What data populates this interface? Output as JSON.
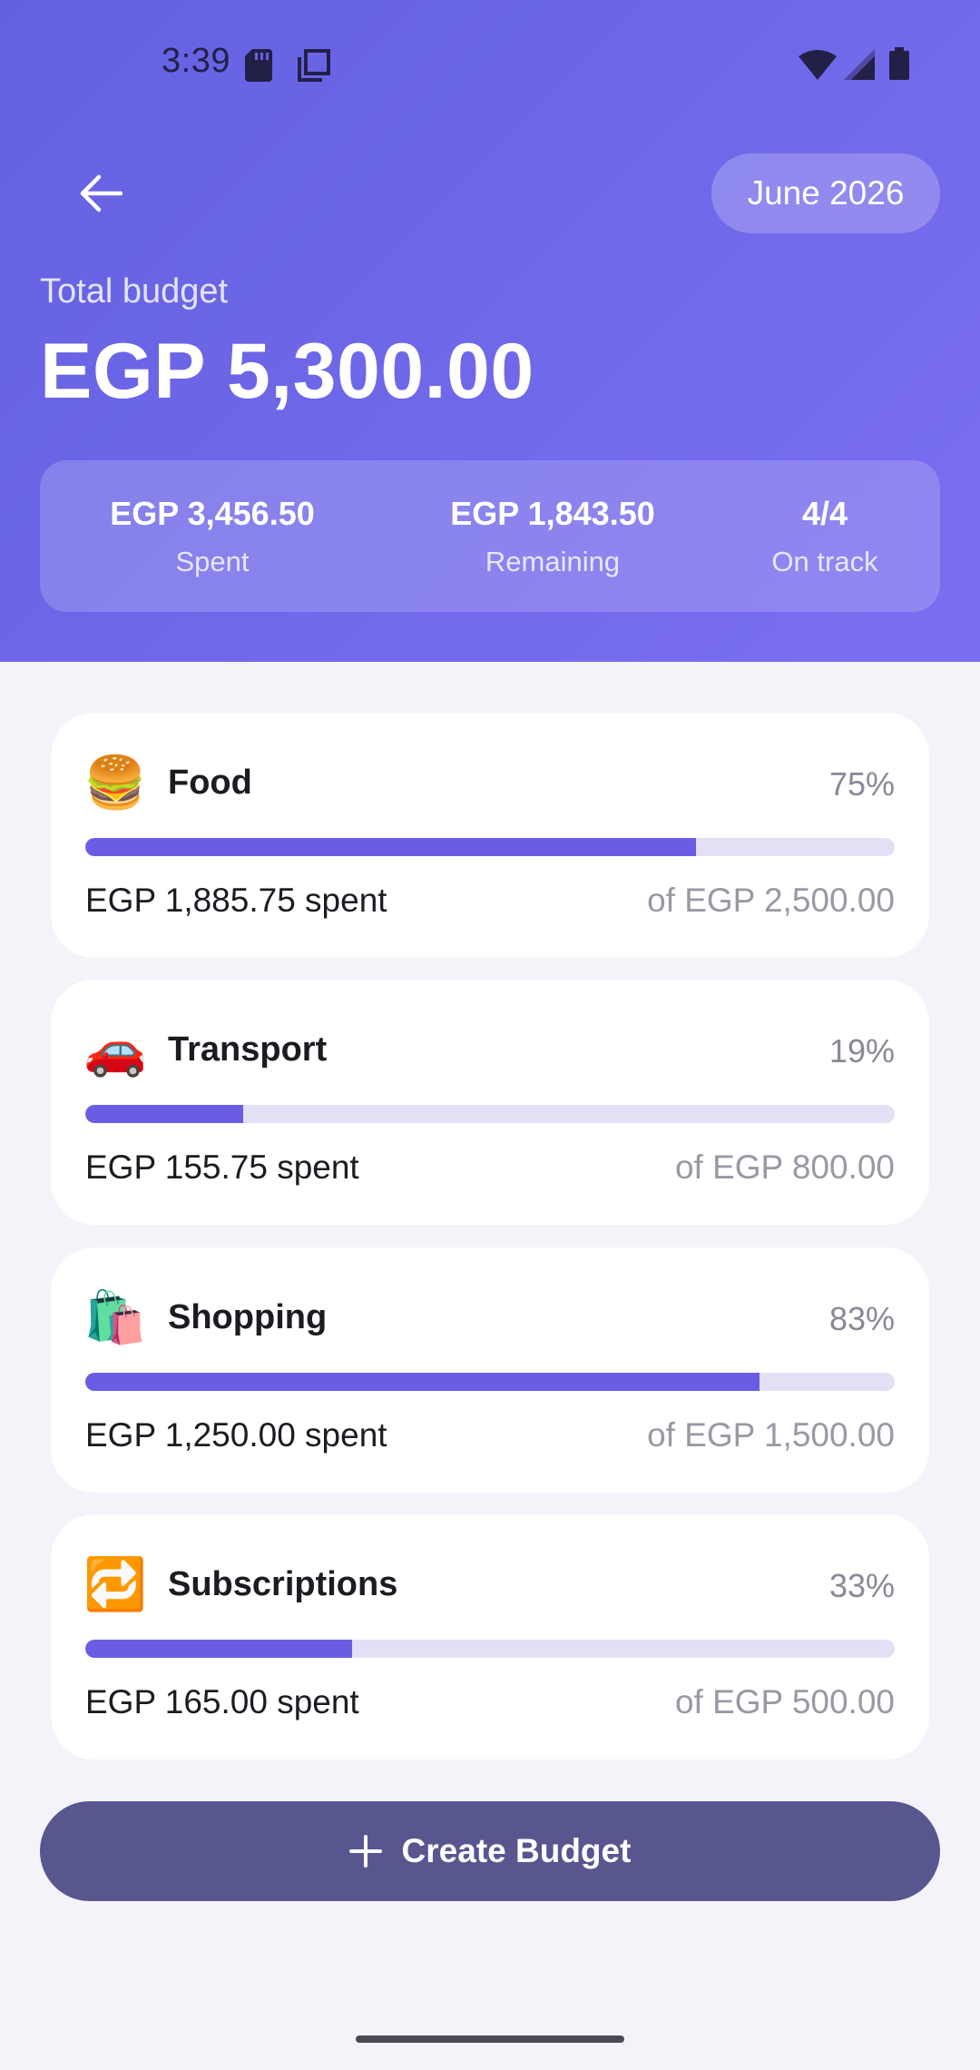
{
  "status_bar": {
    "time": "3:39"
  },
  "header": {
    "month": "June 2026",
    "total_label": "Total budget",
    "total_amount": "EGP 5,300.00",
    "stats": {
      "spent_value": "EGP 3,456.50",
      "spent_label": "Spent",
      "remaining_value": "EGP 1,843.50",
      "remaining_label": "Remaining",
      "track_value": "4/4",
      "track_label": "On track"
    }
  },
  "budgets": [
    {
      "emoji": "🍔",
      "icon": "hamburger-icon",
      "name": "Food",
      "percent": "75%",
      "progress": 0.754,
      "spent": "EGP 1,885.75 spent",
      "limit": "of EGP 2,500.00"
    },
    {
      "emoji": "🚗",
      "icon": "car-icon",
      "name": "Transport",
      "percent": "19%",
      "progress": 0.195,
      "spent": "EGP 155.75 spent",
      "limit": "of EGP 800.00"
    },
    {
      "emoji": "🛍️",
      "icon": "shopping-bags-icon",
      "name": "Shopping",
      "percent": "83%",
      "progress": 0.833,
      "spent": "EGP 1,250.00 spent",
      "limit": "of EGP 1,500.00"
    },
    {
      "emoji": "🔁",
      "icon": "repeat-icon",
      "name": "Subscriptions",
      "percent": "33%",
      "progress": 0.33,
      "spent": "EGP 165.00 spent",
      "limit": "of EGP 500.00"
    }
  ],
  "create_button": {
    "label": "Create Budget"
  },
  "colors": {
    "header_start": "#6461e1",
    "header_end": "#7a6ff0",
    "progress_fill": "#6a5de4",
    "progress_track": "#e2e0f5",
    "button": "#58568f",
    "background": "#f4f3fa"
  }
}
